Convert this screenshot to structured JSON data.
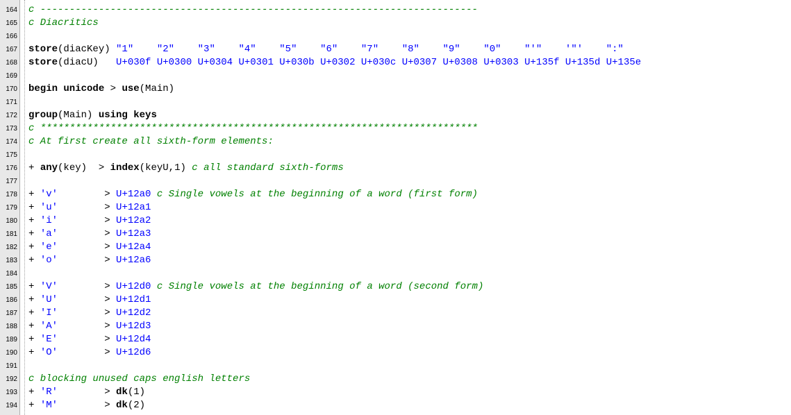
{
  "editor": {
    "title": "",
    "lines": [
      {
        "n": "164",
        "tokens": [
          {
            "t": "c ---------------------------------------------------------------------------",
            "k": "cm"
          }
        ]
      },
      {
        "n": "165",
        "tokens": [
          {
            "t": "c Diacritics",
            "k": "cm"
          }
        ]
      },
      {
        "n": "166",
        "tokens": []
      },
      {
        "n": "167",
        "tokens": [
          {
            "t": "store",
            "k": "kw"
          },
          {
            "t": "(diacKey) ",
            "k": "op"
          },
          {
            "t": "\"1\"    \"2\"    \"3\"    \"4\"    \"5\"    \"6\"    \"7\"    \"8\"    \"9\"    \"0\"    \"'\"    '\"'    \":\"",
            "k": "str"
          }
        ]
      },
      {
        "n": "168",
        "tokens": [
          {
            "t": "store",
            "k": "kw"
          },
          {
            "t": "(diacU)   ",
            "k": "op"
          },
          {
            "t": "U+030f U+0300 U+0304 U+0301 U+030b U+0302 U+030c U+0307 U+0308 U+0303 U+135f U+135d U+135e",
            "k": "uni"
          }
        ]
      },
      {
        "n": "169",
        "tokens": []
      },
      {
        "n": "170",
        "tokens": [
          {
            "t": "begin unicode",
            "k": "kw"
          },
          {
            "t": " > ",
            "k": "op"
          },
          {
            "t": "use",
            "k": "kw"
          },
          {
            "t": "(Main)",
            "k": "op"
          }
        ]
      },
      {
        "n": "171",
        "tokens": []
      },
      {
        "n": "172",
        "tokens": [
          {
            "t": "group",
            "k": "kw"
          },
          {
            "t": "(Main) ",
            "k": "op"
          },
          {
            "t": "using keys",
            "k": "kw"
          }
        ]
      },
      {
        "n": "173",
        "tokens": [
          {
            "t": "c ***************************************************************************",
            "k": "cm"
          }
        ]
      },
      {
        "n": "174",
        "tokens": [
          {
            "t": "c At first create all sixth-form elements:",
            "k": "cm"
          }
        ]
      },
      {
        "n": "175",
        "tokens": []
      },
      {
        "n": "176",
        "tokens": [
          {
            "t": "+ ",
            "k": "op"
          },
          {
            "t": "any",
            "k": "kw"
          },
          {
            "t": "(key)  > ",
            "k": "op"
          },
          {
            "t": "index",
            "k": "kw"
          },
          {
            "t": "(keyU,1) ",
            "k": "op"
          },
          {
            "t": "c all standard sixth-forms",
            "k": "cm"
          }
        ]
      },
      {
        "n": "177",
        "tokens": []
      },
      {
        "n": "178",
        "tokens": [
          {
            "t": "+ ",
            "k": "op"
          },
          {
            "t": "'v'",
            "k": "str"
          },
          {
            "t": "        > ",
            "k": "op"
          },
          {
            "t": "U+12a0",
            "k": "uni"
          },
          {
            "t": " ",
            "k": "op"
          },
          {
            "t": "c Single vowels at the beginning of a word (first form)",
            "k": "cm"
          }
        ]
      },
      {
        "n": "179",
        "tokens": [
          {
            "t": "+ ",
            "k": "op"
          },
          {
            "t": "'u'",
            "k": "str"
          },
          {
            "t": "        > ",
            "k": "op"
          },
          {
            "t": "U+12a1",
            "k": "uni"
          }
        ]
      },
      {
        "n": "180",
        "tokens": [
          {
            "t": "+ ",
            "k": "op"
          },
          {
            "t": "'i'",
            "k": "str"
          },
          {
            "t": "        > ",
            "k": "op"
          },
          {
            "t": "U+12a2",
            "k": "uni"
          }
        ]
      },
      {
        "n": "181",
        "tokens": [
          {
            "t": "+ ",
            "k": "op"
          },
          {
            "t": "'a'",
            "k": "str"
          },
          {
            "t": "        > ",
            "k": "op"
          },
          {
            "t": "U+12a3",
            "k": "uni"
          }
        ]
      },
      {
        "n": "182",
        "tokens": [
          {
            "t": "+ ",
            "k": "op"
          },
          {
            "t": "'e'",
            "k": "str"
          },
          {
            "t": "        > ",
            "k": "op"
          },
          {
            "t": "U+12a4",
            "k": "uni"
          }
        ]
      },
      {
        "n": "183",
        "tokens": [
          {
            "t": "+ ",
            "k": "op"
          },
          {
            "t": "'o'",
            "k": "str"
          },
          {
            "t": "        > ",
            "k": "op"
          },
          {
            "t": "U+12a6",
            "k": "uni"
          }
        ]
      },
      {
        "n": "184",
        "tokens": []
      },
      {
        "n": "185",
        "tokens": [
          {
            "t": "+ ",
            "k": "op"
          },
          {
            "t": "'V'",
            "k": "str"
          },
          {
            "t": "        > ",
            "k": "op"
          },
          {
            "t": "U+12d0",
            "k": "uni"
          },
          {
            "t": " ",
            "k": "op"
          },
          {
            "t": "c Single vowels at the beginning of a word (second form)",
            "k": "cm"
          }
        ]
      },
      {
        "n": "186",
        "tokens": [
          {
            "t": "+ ",
            "k": "op"
          },
          {
            "t": "'U'",
            "k": "str"
          },
          {
            "t": "        > ",
            "k": "op"
          },
          {
            "t": "U+12d1",
            "k": "uni"
          }
        ]
      },
      {
        "n": "187",
        "tokens": [
          {
            "t": "+ ",
            "k": "op"
          },
          {
            "t": "'I'",
            "k": "str"
          },
          {
            "t": "        > ",
            "k": "op"
          },
          {
            "t": "U+12d2",
            "k": "uni"
          }
        ]
      },
      {
        "n": "188",
        "tokens": [
          {
            "t": "+ ",
            "k": "op"
          },
          {
            "t": "'A'",
            "k": "str"
          },
          {
            "t": "        > ",
            "k": "op"
          },
          {
            "t": "U+12d3",
            "k": "uni"
          }
        ]
      },
      {
        "n": "189",
        "tokens": [
          {
            "t": "+ ",
            "k": "op"
          },
          {
            "t": "'E'",
            "k": "str"
          },
          {
            "t": "        > ",
            "k": "op"
          },
          {
            "t": "U+12d4",
            "k": "uni"
          }
        ]
      },
      {
        "n": "190",
        "tokens": [
          {
            "t": "+ ",
            "k": "op"
          },
          {
            "t": "'O'",
            "k": "str"
          },
          {
            "t": "        > ",
            "k": "op"
          },
          {
            "t": "U+12d6",
            "k": "uni"
          }
        ]
      },
      {
        "n": "191",
        "tokens": []
      },
      {
        "n": "192",
        "tokens": [
          {
            "t": "c blocking unused caps english letters",
            "k": "cm"
          }
        ]
      },
      {
        "n": "193",
        "tokens": [
          {
            "t": "+ ",
            "k": "op"
          },
          {
            "t": "'R'",
            "k": "str"
          },
          {
            "t": "        > ",
            "k": "op"
          },
          {
            "t": "dk",
            "k": "kw"
          },
          {
            "t": "(1)",
            "k": "op"
          }
        ]
      },
      {
        "n": "194",
        "tokens": [
          {
            "t": "+ ",
            "k": "op"
          },
          {
            "t": "'M'",
            "k": "str"
          },
          {
            "t": "        > ",
            "k": "op"
          },
          {
            "t": "dk",
            "k": "kw"
          },
          {
            "t": "(2)",
            "k": "op"
          }
        ]
      }
    ]
  },
  "colors": {
    "keyword": "#000000",
    "comment": "#008000",
    "string": "#0000ff",
    "unicode": "#0000ff",
    "gutter": "#e8e8e8"
  }
}
